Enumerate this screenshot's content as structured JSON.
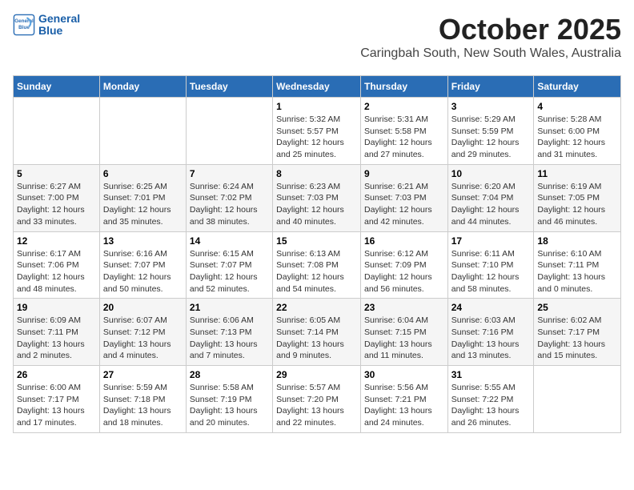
{
  "header": {
    "logo_line1": "General",
    "logo_line2": "Blue",
    "month_title": "October 2025",
    "subtitle": "Caringbah South, New South Wales, Australia"
  },
  "weekdays": [
    "Sunday",
    "Monday",
    "Tuesday",
    "Wednesday",
    "Thursday",
    "Friday",
    "Saturday"
  ],
  "weeks": [
    [
      {
        "day": "",
        "info": ""
      },
      {
        "day": "",
        "info": ""
      },
      {
        "day": "",
        "info": ""
      },
      {
        "day": "1",
        "info": "Sunrise: 5:32 AM\nSunset: 5:57 PM\nDaylight: 12 hours\nand 25 minutes."
      },
      {
        "day": "2",
        "info": "Sunrise: 5:31 AM\nSunset: 5:58 PM\nDaylight: 12 hours\nand 27 minutes."
      },
      {
        "day": "3",
        "info": "Sunrise: 5:29 AM\nSunset: 5:59 PM\nDaylight: 12 hours\nand 29 minutes."
      },
      {
        "day": "4",
        "info": "Sunrise: 5:28 AM\nSunset: 6:00 PM\nDaylight: 12 hours\nand 31 minutes."
      }
    ],
    [
      {
        "day": "5",
        "info": "Sunrise: 6:27 AM\nSunset: 7:00 PM\nDaylight: 12 hours\nand 33 minutes."
      },
      {
        "day": "6",
        "info": "Sunrise: 6:25 AM\nSunset: 7:01 PM\nDaylight: 12 hours\nand 35 minutes."
      },
      {
        "day": "7",
        "info": "Sunrise: 6:24 AM\nSunset: 7:02 PM\nDaylight: 12 hours\nand 38 minutes."
      },
      {
        "day": "8",
        "info": "Sunrise: 6:23 AM\nSunset: 7:03 PM\nDaylight: 12 hours\nand 40 minutes."
      },
      {
        "day": "9",
        "info": "Sunrise: 6:21 AM\nSunset: 7:03 PM\nDaylight: 12 hours\nand 42 minutes."
      },
      {
        "day": "10",
        "info": "Sunrise: 6:20 AM\nSunset: 7:04 PM\nDaylight: 12 hours\nand 44 minutes."
      },
      {
        "day": "11",
        "info": "Sunrise: 6:19 AM\nSunset: 7:05 PM\nDaylight: 12 hours\nand 46 minutes."
      }
    ],
    [
      {
        "day": "12",
        "info": "Sunrise: 6:17 AM\nSunset: 7:06 PM\nDaylight: 12 hours\nand 48 minutes."
      },
      {
        "day": "13",
        "info": "Sunrise: 6:16 AM\nSunset: 7:07 PM\nDaylight: 12 hours\nand 50 minutes."
      },
      {
        "day": "14",
        "info": "Sunrise: 6:15 AM\nSunset: 7:07 PM\nDaylight: 12 hours\nand 52 minutes."
      },
      {
        "day": "15",
        "info": "Sunrise: 6:13 AM\nSunset: 7:08 PM\nDaylight: 12 hours\nand 54 minutes."
      },
      {
        "day": "16",
        "info": "Sunrise: 6:12 AM\nSunset: 7:09 PM\nDaylight: 12 hours\nand 56 minutes."
      },
      {
        "day": "17",
        "info": "Sunrise: 6:11 AM\nSunset: 7:10 PM\nDaylight: 12 hours\nand 58 minutes."
      },
      {
        "day": "18",
        "info": "Sunrise: 6:10 AM\nSunset: 7:11 PM\nDaylight: 13 hours\nand 0 minutes."
      }
    ],
    [
      {
        "day": "19",
        "info": "Sunrise: 6:09 AM\nSunset: 7:11 PM\nDaylight: 13 hours\nand 2 minutes."
      },
      {
        "day": "20",
        "info": "Sunrise: 6:07 AM\nSunset: 7:12 PM\nDaylight: 13 hours\nand 4 minutes."
      },
      {
        "day": "21",
        "info": "Sunrise: 6:06 AM\nSunset: 7:13 PM\nDaylight: 13 hours\nand 7 minutes."
      },
      {
        "day": "22",
        "info": "Sunrise: 6:05 AM\nSunset: 7:14 PM\nDaylight: 13 hours\nand 9 minutes."
      },
      {
        "day": "23",
        "info": "Sunrise: 6:04 AM\nSunset: 7:15 PM\nDaylight: 13 hours\nand 11 minutes."
      },
      {
        "day": "24",
        "info": "Sunrise: 6:03 AM\nSunset: 7:16 PM\nDaylight: 13 hours\nand 13 minutes."
      },
      {
        "day": "25",
        "info": "Sunrise: 6:02 AM\nSunset: 7:17 PM\nDaylight: 13 hours\nand 15 minutes."
      }
    ],
    [
      {
        "day": "26",
        "info": "Sunrise: 6:00 AM\nSunset: 7:17 PM\nDaylight: 13 hours\nand 17 minutes."
      },
      {
        "day": "27",
        "info": "Sunrise: 5:59 AM\nSunset: 7:18 PM\nDaylight: 13 hours\nand 18 minutes."
      },
      {
        "day": "28",
        "info": "Sunrise: 5:58 AM\nSunset: 7:19 PM\nDaylight: 13 hours\nand 20 minutes."
      },
      {
        "day": "29",
        "info": "Sunrise: 5:57 AM\nSunset: 7:20 PM\nDaylight: 13 hours\nand 22 minutes."
      },
      {
        "day": "30",
        "info": "Sunrise: 5:56 AM\nSunset: 7:21 PM\nDaylight: 13 hours\nand 24 minutes."
      },
      {
        "day": "31",
        "info": "Sunrise: 5:55 AM\nSunset: 7:22 PM\nDaylight: 13 hours\nand 26 minutes."
      },
      {
        "day": "",
        "info": ""
      }
    ]
  ]
}
